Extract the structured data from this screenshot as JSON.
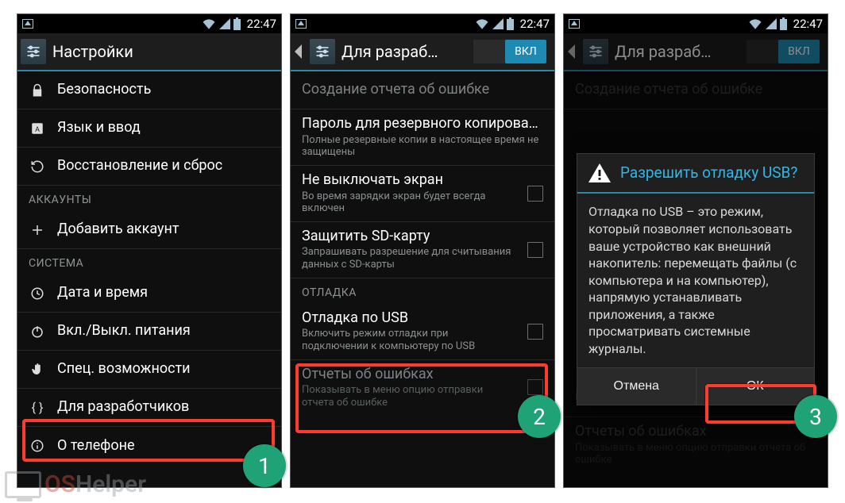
{
  "status": {
    "time": "22:47"
  },
  "screen1": {
    "title": "Настройки",
    "items": {
      "security": "Безопасность",
      "language": "Язык и ввод",
      "backup": "Восстановление и сброс"
    },
    "section_accounts": "АККАУНТЫ",
    "add_account": "Добавить аккаунт",
    "section_system": "СИСТЕМА",
    "datetime": "Дата и время",
    "power": "Вкл./Выкл. питания",
    "accessibility": "Спец. возможности",
    "dev": "Для разработчиков",
    "about": "О телефоне"
  },
  "screen2": {
    "title": "Для разраб…",
    "toggle": "ВКЛ",
    "bugreport": "Создание отчета об ошибке",
    "pwd_title": "Пароль для резервного копирования",
    "pwd_sub": "Полные резервные копии в настоящее время не защищены",
    "stayawake_title": "Не выключать экран",
    "stayawake_sub": "Во время зарядки экран будет всегда включен",
    "sd_title": "Защитить SD-карту",
    "sd_sub": "Запрашивать разрешение для считывания данных с SD-карты",
    "section_debug": "ОТЛАДКА",
    "usb_title": "Отладка по USB",
    "usb_sub": "Включить режим отладки при подключении к компьютеру по USB",
    "reports_title": "Отчеты об ошибках",
    "reports_sub": "Показывать в меню опцию отправки отчета об ошибке"
  },
  "screen3": {
    "title": "Для разраб…",
    "toggle": "ВКЛ",
    "dialog_title": "Разрешить отладку USB?",
    "dialog_body": "Отладка по USB – это режим, который позволяет использовать ваше устройство как внешний накопитель: перемещать файлы (с компьютера и на компьютер), напрямую устанавливать приложения, а также просматривать системные журналы.",
    "cancel": "Отмена",
    "ok": "ОК"
  },
  "steps": {
    "s1": "1",
    "s2": "2",
    "s3": "3"
  },
  "watermark": {
    "a": "OS",
    "b": "Helper"
  }
}
